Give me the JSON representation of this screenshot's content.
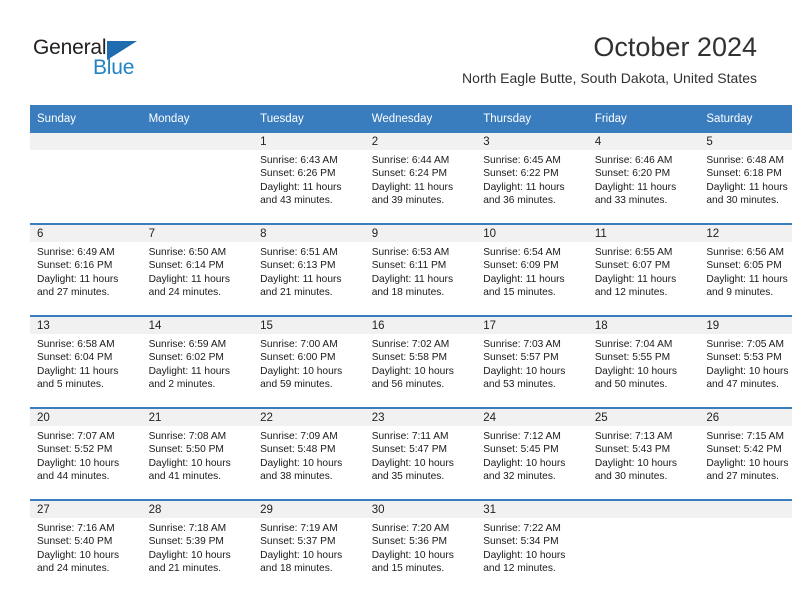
{
  "logo": {
    "text_primary": "General",
    "text_secondary": "Blue",
    "primary_color": "#231f20",
    "secondary_color": "#2283c5",
    "triangle_color": "#1f6cb0"
  },
  "header": {
    "title": "October 2024",
    "location": "North Eagle Butte, South Dakota, United States"
  },
  "theme": {
    "header_bar_color": "#3a7dbf",
    "date_band_color": "#f1f1f1",
    "row_divider_color": "#3a7dbf"
  },
  "weekday_headers": [
    "Sunday",
    "Monday",
    "Tuesday",
    "Wednesday",
    "Thursday",
    "Friday",
    "Saturday"
  ],
  "labels": {
    "sunrise_prefix": "Sunrise:",
    "sunset_prefix": "Sunset:",
    "daylight_prefix": "Daylight:"
  },
  "weeks": [
    [
      {
        "day": "",
        "empty": true,
        "sunrise": "",
        "sunset": "",
        "daylight_line1": "",
        "daylight_line2": ""
      },
      {
        "day": "",
        "empty": true,
        "sunrise": "",
        "sunset": "",
        "daylight_line1": "",
        "daylight_line2": ""
      },
      {
        "day": "1",
        "empty": false,
        "sunrise": "Sunrise: 6:43 AM",
        "sunset": "Sunset: 6:26 PM",
        "daylight_line1": "Daylight: 11 hours",
        "daylight_line2": "and 43 minutes."
      },
      {
        "day": "2",
        "empty": false,
        "sunrise": "Sunrise: 6:44 AM",
        "sunset": "Sunset: 6:24 PM",
        "daylight_line1": "Daylight: 11 hours",
        "daylight_line2": "and 39 minutes."
      },
      {
        "day": "3",
        "empty": false,
        "sunrise": "Sunrise: 6:45 AM",
        "sunset": "Sunset: 6:22 PM",
        "daylight_line1": "Daylight: 11 hours",
        "daylight_line2": "and 36 minutes."
      },
      {
        "day": "4",
        "empty": false,
        "sunrise": "Sunrise: 6:46 AM",
        "sunset": "Sunset: 6:20 PM",
        "daylight_line1": "Daylight: 11 hours",
        "daylight_line2": "and 33 minutes."
      },
      {
        "day": "5",
        "empty": false,
        "sunrise": "Sunrise: 6:48 AM",
        "sunset": "Sunset: 6:18 PM",
        "daylight_line1": "Daylight: 11 hours",
        "daylight_line2": "and 30 minutes."
      }
    ],
    [
      {
        "day": "6",
        "empty": false,
        "sunrise": "Sunrise: 6:49 AM",
        "sunset": "Sunset: 6:16 PM",
        "daylight_line1": "Daylight: 11 hours",
        "daylight_line2": "and 27 minutes."
      },
      {
        "day": "7",
        "empty": false,
        "sunrise": "Sunrise: 6:50 AM",
        "sunset": "Sunset: 6:14 PM",
        "daylight_line1": "Daylight: 11 hours",
        "daylight_line2": "and 24 minutes."
      },
      {
        "day": "8",
        "empty": false,
        "sunrise": "Sunrise: 6:51 AM",
        "sunset": "Sunset: 6:13 PM",
        "daylight_line1": "Daylight: 11 hours",
        "daylight_line2": "and 21 minutes."
      },
      {
        "day": "9",
        "empty": false,
        "sunrise": "Sunrise: 6:53 AM",
        "sunset": "Sunset: 6:11 PM",
        "daylight_line1": "Daylight: 11 hours",
        "daylight_line2": "and 18 minutes."
      },
      {
        "day": "10",
        "empty": false,
        "sunrise": "Sunrise: 6:54 AM",
        "sunset": "Sunset: 6:09 PM",
        "daylight_line1": "Daylight: 11 hours",
        "daylight_line2": "and 15 minutes."
      },
      {
        "day": "11",
        "empty": false,
        "sunrise": "Sunrise: 6:55 AM",
        "sunset": "Sunset: 6:07 PM",
        "daylight_line1": "Daylight: 11 hours",
        "daylight_line2": "and 12 minutes."
      },
      {
        "day": "12",
        "empty": false,
        "sunrise": "Sunrise: 6:56 AM",
        "sunset": "Sunset: 6:05 PM",
        "daylight_line1": "Daylight: 11 hours",
        "daylight_line2": "and 9 minutes."
      }
    ],
    [
      {
        "day": "13",
        "empty": false,
        "sunrise": "Sunrise: 6:58 AM",
        "sunset": "Sunset: 6:04 PM",
        "daylight_line1": "Daylight: 11 hours",
        "daylight_line2": "and 5 minutes."
      },
      {
        "day": "14",
        "empty": false,
        "sunrise": "Sunrise: 6:59 AM",
        "sunset": "Sunset: 6:02 PM",
        "daylight_line1": "Daylight: 11 hours",
        "daylight_line2": "and 2 minutes."
      },
      {
        "day": "15",
        "empty": false,
        "sunrise": "Sunrise: 7:00 AM",
        "sunset": "Sunset: 6:00 PM",
        "daylight_line1": "Daylight: 10 hours",
        "daylight_line2": "and 59 minutes."
      },
      {
        "day": "16",
        "empty": false,
        "sunrise": "Sunrise: 7:02 AM",
        "sunset": "Sunset: 5:58 PM",
        "daylight_line1": "Daylight: 10 hours",
        "daylight_line2": "and 56 minutes."
      },
      {
        "day": "17",
        "empty": false,
        "sunrise": "Sunrise: 7:03 AM",
        "sunset": "Sunset: 5:57 PM",
        "daylight_line1": "Daylight: 10 hours",
        "daylight_line2": "and 53 minutes."
      },
      {
        "day": "18",
        "empty": false,
        "sunrise": "Sunrise: 7:04 AM",
        "sunset": "Sunset: 5:55 PM",
        "daylight_line1": "Daylight: 10 hours",
        "daylight_line2": "and 50 minutes."
      },
      {
        "day": "19",
        "empty": false,
        "sunrise": "Sunrise: 7:05 AM",
        "sunset": "Sunset: 5:53 PM",
        "daylight_line1": "Daylight: 10 hours",
        "daylight_line2": "and 47 minutes."
      }
    ],
    [
      {
        "day": "20",
        "empty": false,
        "sunrise": "Sunrise: 7:07 AM",
        "sunset": "Sunset: 5:52 PM",
        "daylight_line1": "Daylight: 10 hours",
        "daylight_line2": "and 44 minutes."
      },
      {
        "day": "21",
        "empty": false,
        "sunrise": "Sunrise: 7:08 AM",
        "sunset": "Sunset: 5:50 PM",
        "daylight_line1": "Daylight: 10 hours",
        "daylight_line2": "and 41 minutes."
      },
      {
        "day": "22",
        "empty": false,
        "sunrise": "Sunrise: 7:09 AM",
        "sunset": "Sunset: 5:48 PM",
        "daylight_line1": "Daylight: 10 hours",
        "daylight_line2": "and 38 minutes."
      },
      {
        "day": "23",
        "empty": false,
        "sunrise": "Sunrise: 7:11 AM",
        "sunset": "Sunset: 5:47 PM",
        "daylight_line1": "Daylight: 10 hours",
        "daylight_line2": "and 35 minutes."
      },
      {
        "day": "24",
        "empty": false,
        "sunrise": "Sunrise: 7:12 AM",
        "sunset": "Sunset: 5:45 PM",
        "daylight_line1": "Daylight: 10 hours",
        "daylight_line2": "and 32 minutes."
      },
      {
        "day": "25",
        "empty": false,
        "sunrise": "Sunrise: 7:13 AM",
        "sunset": "Sunset: 5:43 PM",
        "daylight_line1": "Daylight: 10 hours",
        "daylight_line2": "and 30 minutes."
      },
      {
        "day": "26",
        "empty": false,
        "sunrise": "Sunrise: 7:15 AM",
        "sunset": "Sunset: 5:42 PM",
        "daylight_line1": "Daylight: 10 hours",
        "daylight_line2": "and 27 minutes."
      }
    ],
    [
      {
        "day": "27",
        "empty": false,
        "sunrise": "Sunrise: 7:16 AM",
        "sunset": "Sunset: 5:40 PM",
        "daylight_line1": "Daylight: 10 hours",
        "daylight_line2": "and 24 minutes."
      },
      {
        "day": "28",
        "empty": false,
        "sunrise": "Sunrise: 7:18 AM",
        "sunset": "Sunset: 5:39 PM",
        "daylight_line1": "Daylight: 10 hours",
        "daylight_line2": "and 21 minutes."
      },
      {
        "day": "29",
        "empty": false,
        "sunrise": "Sunrise: 7:19 AM",
        "sunset": "Sunset: 5:37 PM",
        "daylight_line1": "Daylight: 10 hours",
        "daylight_line2": "and 18 minutes."
      },
      {
        "day": "30",
        "empty": false,
        "sunrise": "Sunrise: 7:20 AM",
        "sunset": "Sunset: 5:36 PM",
        "daylight_line1": "Daylight: 10 hours",
        "daylight_line2": "and 15 minutes."
      },
      {
        "day": "31",
        "empty": false,
        "sunrise": "Sunrise: 7:22 AM",
        "sunset": "Sunset: 5:34 PM",
        "daylight_line1": "Daylight: 10 hours",
        "daylight_line2": "and 12 minutes."
      },
      {
        "day": "",
        "empty": true,
        "sunrise": "",
        "sunset": "",
        "daylight_line1": "",
        "daylight_line2": ""
      },
      {
        "day": "",
        "empty": true,
        "sunrise": "",
        "sunset": "",
        "daylight_line1": "",
        "daylight_line2": ""
      }
    ]
  ]
}
